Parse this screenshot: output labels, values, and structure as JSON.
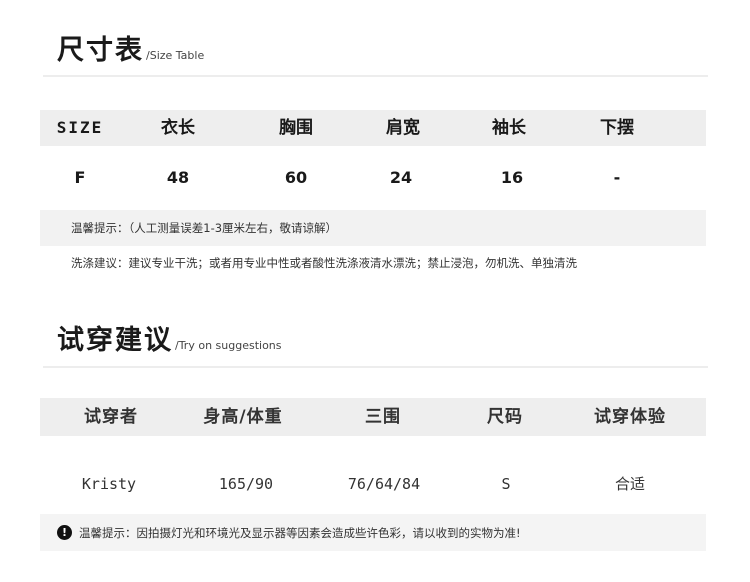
{
  "size_section": {
    "title_zh": "尺寸表",
    "title_en": "/Size Table",
    "headers": [
      "SIZE",
      "衣长",
      "胸围",
      "肩宽",
      "袖长",
      "下摆"
    ],
    "rows": [
      [
        "F",
        "48",
        "60",
        "24",
        "16",
        "-"
      ]
    ],
    "note": "温馨提示：（人工测量误差1-3厘米左右，敬请谅解）",
    "wash": "洗涤建议：建议专业干洗；或者用专业中性或者酸性洗涤液清水漂洗；禁止浸泡，勿机洗、单独清洗"
  },
  "try_section": {
    "title_zh": "试穿建议",
    "title_en": "/Try on suggestions",
    "headers": [
      "试穿者",
      "身高/体重",
      "三围",
      "尺码",
      "试穿体验"
    ],
    "rows": [
      [
        "Kristy",
        "165/90",
        "76/64/84",
        "S",
        "合适"
      ]
    ],
    "warning_icon": "exclamation-circle-icon",
    "warning_icon_glyph": "!",
    "warning": "温馨提示：因拍摄灯光和环境光及显示器等因素会造成些许色彩，请以收到的实物为准!"
  }
}
